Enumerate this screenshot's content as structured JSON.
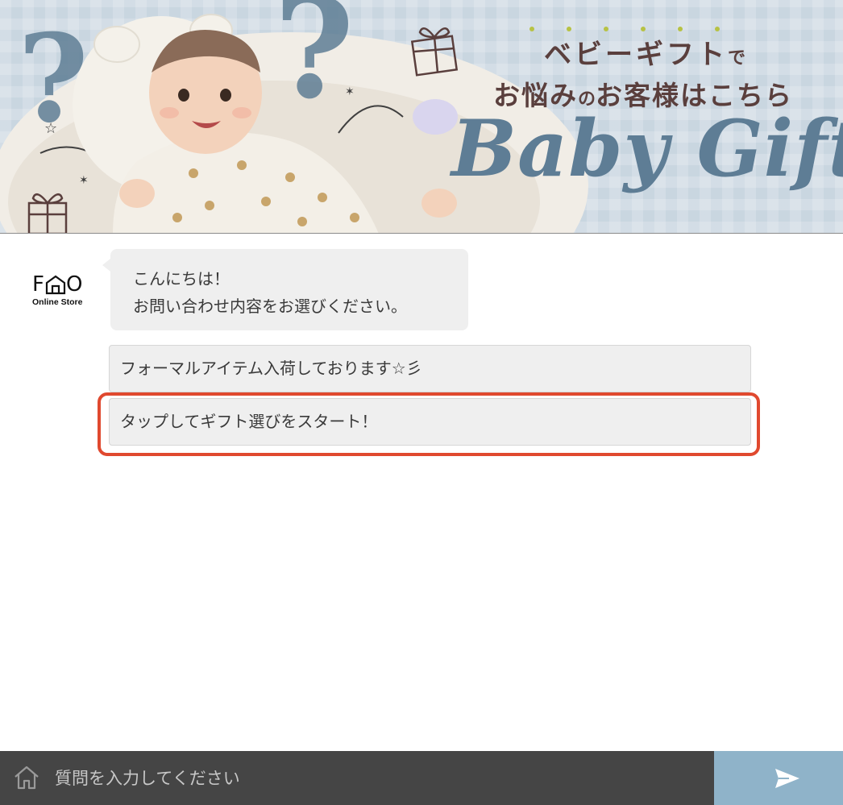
{
  "banner": {
    "line1_main": "ベビーギフト",
    "line1_small": "で",
    "line2_a": "お悩み",
    "line2_b": "の",
    "line2_c": "お客様はこちら",
    "script": "Baby Gift",
    "accent_color": "#5e7d95",
    "text_color": "#5a3f3d"
  },
  "logo": {
    "mark": "FO",
    "sub": "Online Store"
  },
  "chat": {
    "greeting_line1": "こんにちは！",
    "greeting_line2": "お問い合わせ内容をお選びください。",
    "choices": [
      "フォーマルアイテム入荷しております☆彡",
      "タップしてギフト選びをスタート！"
    ],
    "highlight_color": "#e0492f"
  },
  "input_bar": {
    "placeholder": "質問を入力してください",
    "icon": "home-icon",
    "send_icon": "send-icon",
    "send_color": "#8fb3c9"
  }
}
